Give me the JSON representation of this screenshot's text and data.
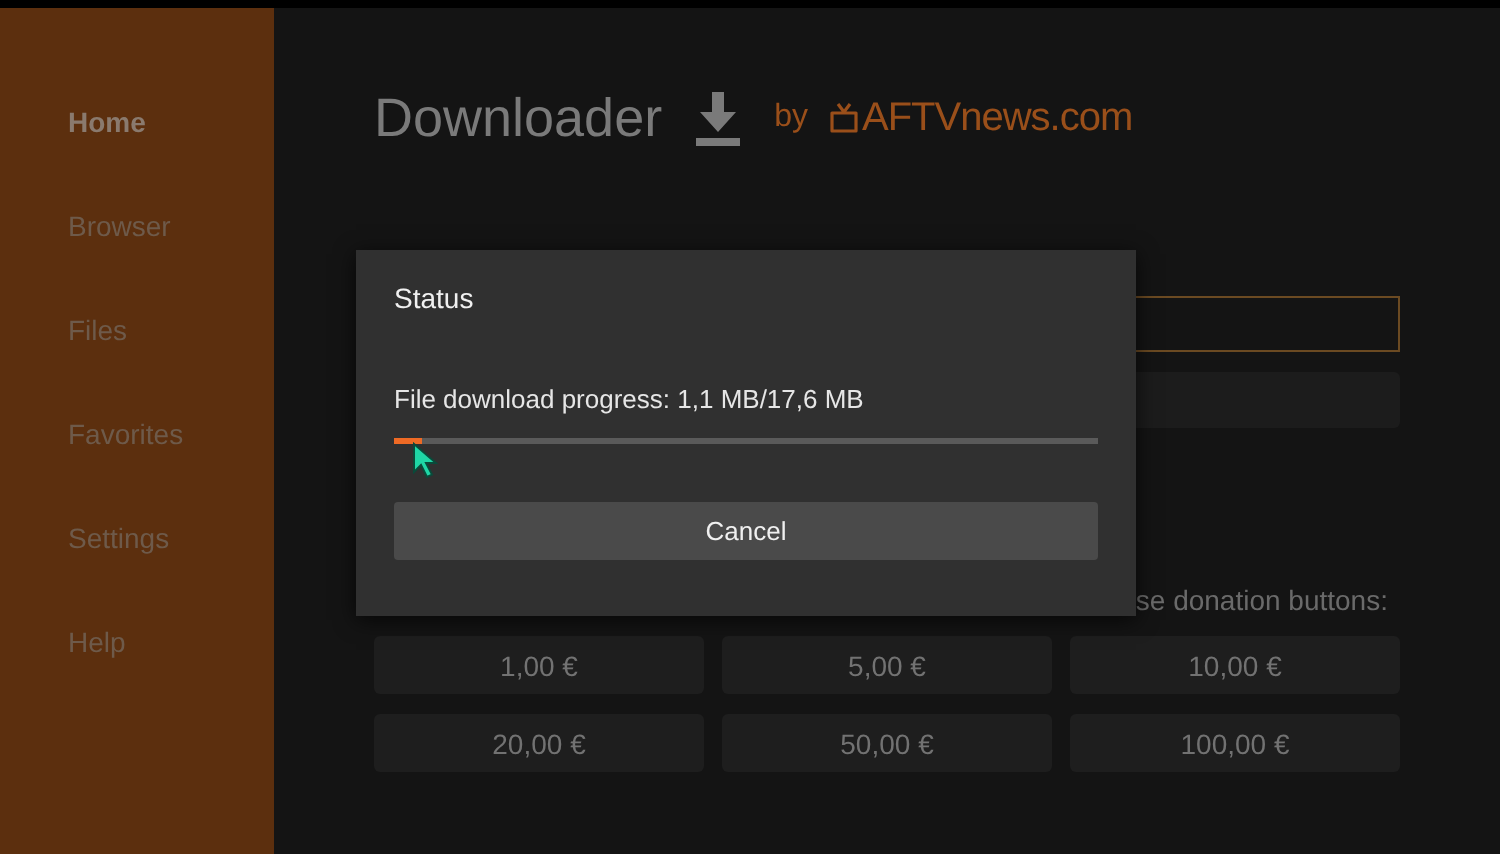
{
  "sidebar": {
    "items": [
      {
        "label": "Home",
        "selected": true
      },
      {
        "label": "Browser",
        "selected": false
      },
      {
        "label": "Files",
        "selected": false
      },
      {
        "label": "Favorites",
        "selected": false
      },
      {
        "label": "Settings",
        "selected": false
      },
      {
        "label": "Help",
        "selected": false
      }
    ]
  },
  "header": {
    "title": "Downloader",
    "by": "by",
    "brand": "AFTVnews.com"
  },
  "donation": {
    "caption": "se donation buttons:",
    "amounts": [
      "1,00 €",
      "5,00 €",
      "10,00 €",
      "20,00 €",
      "50,00 €",
      "100,00 €"
    ]
  },
  "dialog": {
    "title": "Status",
    "message": "File download progress: 1,1 MB/17,6 MB",
    "level": 0.04,
    "button": "Cancel"
  }
}
